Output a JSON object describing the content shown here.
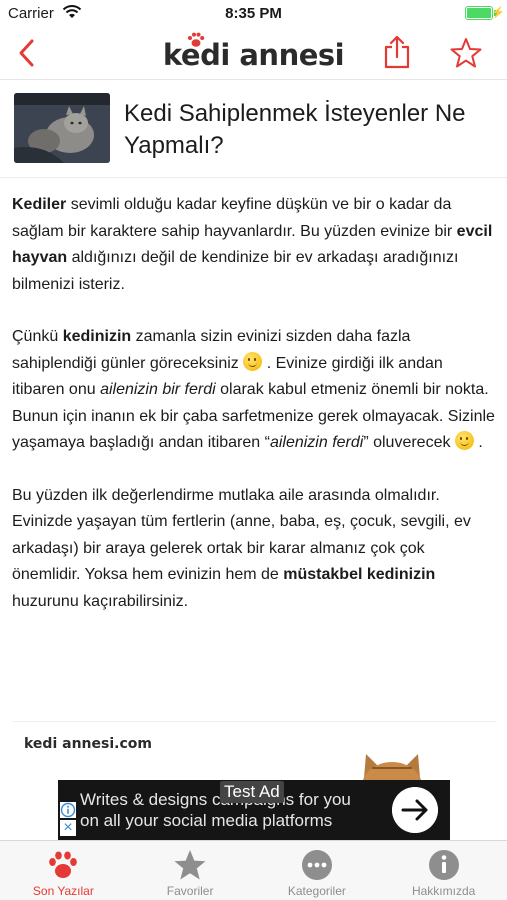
{
  "status": {
    "carrier": "Carrier",
    "time": "8:35 PM"
  },
  "nav": {
    "logo": "kedi annesi",
    "accent": "#e53935"
  },
  "article": {
    "title": "Kedi Sahiplenmek İsteyenler Ne Yapmalı?",
    "p1": {
      "b1": "Kediler",
      "t1": " sevimli olduğu kadar keyfine düşkün ve bir o kadar da sağlam bir karaktere sahip hayvanlardır. Bu yüzden evinize bir ",
      "b2": "evcil hayvan",
      "t2": " aldığınızı değil de kendinize bir ev arkadaşı aradığınızı bilmenizi isteriz."
    },
    "p2": {
      "t1": "Çünkü ",
      "b1": "kedinizin",
      "t2": " zamanla sizin evinizi sizden daha fazla sahiplendiği günler göreceksiniz ",
      "t3": " . Evinize girdiği ilk andan itibaren onu ",
      "i1": "ailenizin bir ferdi",
      "t4": " olarak kabul etmeniz önemli bir nokta. Bunun için inanın ek bir çaba sarfetmenize gerek olmayacak. Sizinle yaşamaya başladığı andan itibaren “",
      "i2": "ailenizin ferdi",
      "t5": "” oluverecek ",
      "t6": " ."
    },
    "p3": {
      "t1": "Bu yüzden ilk değerlendirme mutlaka aile arasında olmalıdır. Evinizde yaşayan tüm fertlerin (anne, baba, eş, çocuk, sevgili, ev arkadaşı) bir araya gelerek ortak bir karar almanız çok çok önemlidir. Yoksa hem evinizin hem de ",
      "b1": "müstakbel kedinizin",
      "t2": " huzurunu kaçırabilirsiniz."
    }
  },
  "promo": {
    "brand": "kedi annesi.com"
  },
  "ad": {
    "badge": "Test Ad",
    "line1": "Writes & designs campaigns for you",
    "line2": "on all your social media platforms"
  },
  "tabs": [
    {
      "label": "Son Yazılar",
      "icon": "paw-icon"
    },
    {
      "label": "Favoriler",
      "icon": "star-icon"
    },
    {
      "label": "Kategoriler",
      "icon": "more-icon"
    },
    {
      "label": "Hakkımızda",
      "icon": "info-icon"
    }
  ]
}
